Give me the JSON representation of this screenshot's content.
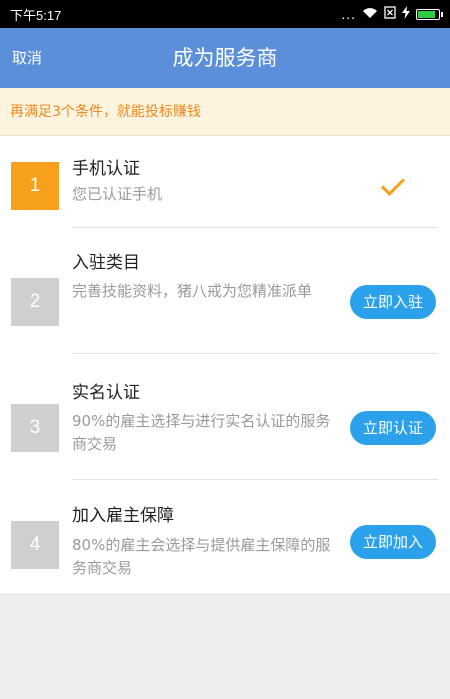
{
  "status_bar": {
    "time": "下午5:17",
    "dots": "...",
    "icons": [
      "wifi-icon",
      "sim-icon",
      "charging-icon",
      "battery-icon"
    ],
    "battery_level": 0.9
  },
  "navbar": {
    "cancel_label": "取消",
    "title": "成为服务商"
  },
  "notice": {
    "text": "再满足3个条件，就能投标赚钱"
  },
  "steps": [
    {
      "number": "1",
      "title": "手机认证",
      "desc": "您已认证手机",
      "status": "done",
      "status_icon": "checkmark-icon"
    },
    {
      "number": "2",
      "title": "入驻类目",
      "desc": "完善技能资料，猪八戒为您精准派单",
      "status": "pending",
      "button": "立即入驻"
    },
    {
      "number": "3",
      "title": "实名认证",
      "desc": "90%的雇主选择与进行实名认证的服务商交易",
      "status": "pending",
      "button": "立即认证"
    },
    {
      "number": "4",
      "title": "加入雇主保障",
      "desc": "80%的雇主会选择与提供雇主保障的服务商交易",
      "status": "pending",
      "button": "立即加入"
    }
  ],
  "colors": {
    "nav_blue": "#5b8fd9",
    "active_orange": "#f6a01c",
    "button_blue": "#2aa1ea",
    "notice_bg": "#fdf3de",
    "notice_text": "#f08a1c"
  }
}
